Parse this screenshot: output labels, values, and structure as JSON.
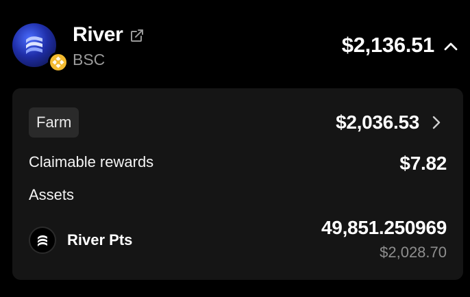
{
  "position": {
    "protocol_name": "River",
    "chain": "BSC",
    "total_value": "$2,136.51",
    "logo_icon": "river-logo-icon",
    "chain_icon": "bnb-chain-icon",
    "external_link_icon": "external-link-icon",
    "collapse_icon": "chevron-up-icon"
  },
  "farm": {
    "tag": "Farm",
    "value": "$2,036.53",
    "open_icon": "chevron-right-icon",
    "claimable_label": "Claimable rewards",
    "claimable_value": "$7.82",
    "assets_label": "Assets",
    "assets": [
      {
        "name": "River Pts",
        "amount": "49,851.250969",
        "usd_value": "$2,028.70",
        "icon": "river-pts-icon"
      }
    ]
  },
  "colors": {
    "background": "#000000",
    "card": "#151515",
    "tag_bg": "#2a2a2a",
    "muted_text": "#9a9a9a",
    "brand_blue": "#3b5cff",
    "bnb_yellow": "#f3ba2f"
  }
}
